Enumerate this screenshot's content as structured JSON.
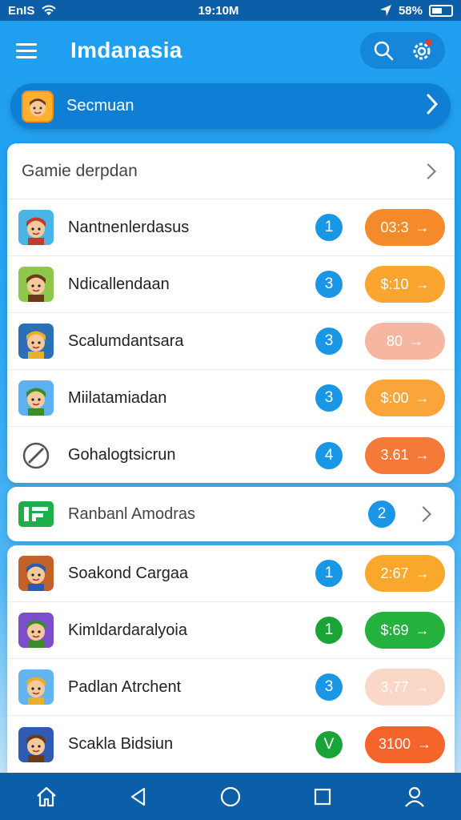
{
  "status_bar": {
    "carrier": "EnIS",
    "time": "19:10M",
    "battery": "58%"
  },
  "app": {
    "title": "Imdanasia"
  },
  "profile": {
    "name": "Secmuan"
  },
  "section1": {
    "header": "Gamie derpdan",
    "games": [
      {
        "name": "Nantnenlerdasus",
        "badge": "1",
        "badge_color": "#1a96e6",
        "price": "03:3",
        "price_color": "#f58a2a",
        "icon": "elf-character-icon",
        "icon_bg": "#4cb3e6"
      },
      {
        "name": "Ndicallendaan",
        "badge": "3",
        "badge_color": "#1a96e6",
        "price": "$:10",
        "price_color": "#f9a52f",
        "icon": "goblin-character-icon",
        "icon_bg": "#8fc74a"
      },
      {
        "name": "Scalumdantsara",
        "badge": "3",
        "badge_color": "#1a96e6",
        "price": "80",
        "price_color": "#f5b7a0",
        "icon": "warrior-character-icon",
        "icon_bg": "#2d6fb5"
      },
      {
        "name": "Miilatamiadan",
        "badge": "3",
        "badge_color": "#1a96e6",
        "price": "$:00",
        "price_color": "#f9a53a",
        "icon": "miner-character-icon",
        "icon_bg": "#5fb0f0"
      },
      {
        "name": "Gohalogtsicrun",
        "badge": "4",
        "badge_color": "#1a96e6",
        "price": "3.61",
        "price_color": "#f57a3a",
        "icon": "slash-circle-icon",
        "icon_bg": "#ffffff"
      }
    ]
  },
  "section2": {
    "header": "Ranbanl Amodras",
    "badge": "2",
    "icon": "grid-logo-icon"
  },
  "section3": {
    "games": [
      {
        "name": "Soakond Cargaa",
        "badge": "1",
        "badge_color": "#1a96e6",
        "price": "2:67",
        "price_color": "#f9a82c",
        "icon": "hero-character-icon",
        "icon_bg": "#c0622a"
      },
      {
        "name": "Kimldardaralyoia",
        "badge": "1",
        "badge_color": "#1aa336",
        "price": "$:69",
        "price_color": "#25b13d",
        "icon": "robot-character-icon",
        "icon_bg": "#7b4fc9"
      },
      {
        "name": "Padlan Atrchent",
        "badge": "3",
        "badge_color": "#1a96e6",
        "price": "3,77",
        "price_color": "#fbd7c7",
        "icon": "builder-character-icon",
        "icon_bg": "#64b5ef"
      },
      {
        "name": "Scakla Bidsiun",
        "badge": "V",
        "badge_color": "#1aa336",
        "price": "3100",
        "price_color": "#f5642a",
        "icon": "knight-character-icon",
        "icon_bg": "#2f5bb0"
      }
    ]
  },
  "nav": [
    "home-icon",
    "back-icon",
    "circle-home-icon",
    "recents-icon",
    "profile-icon"
  ]
}
